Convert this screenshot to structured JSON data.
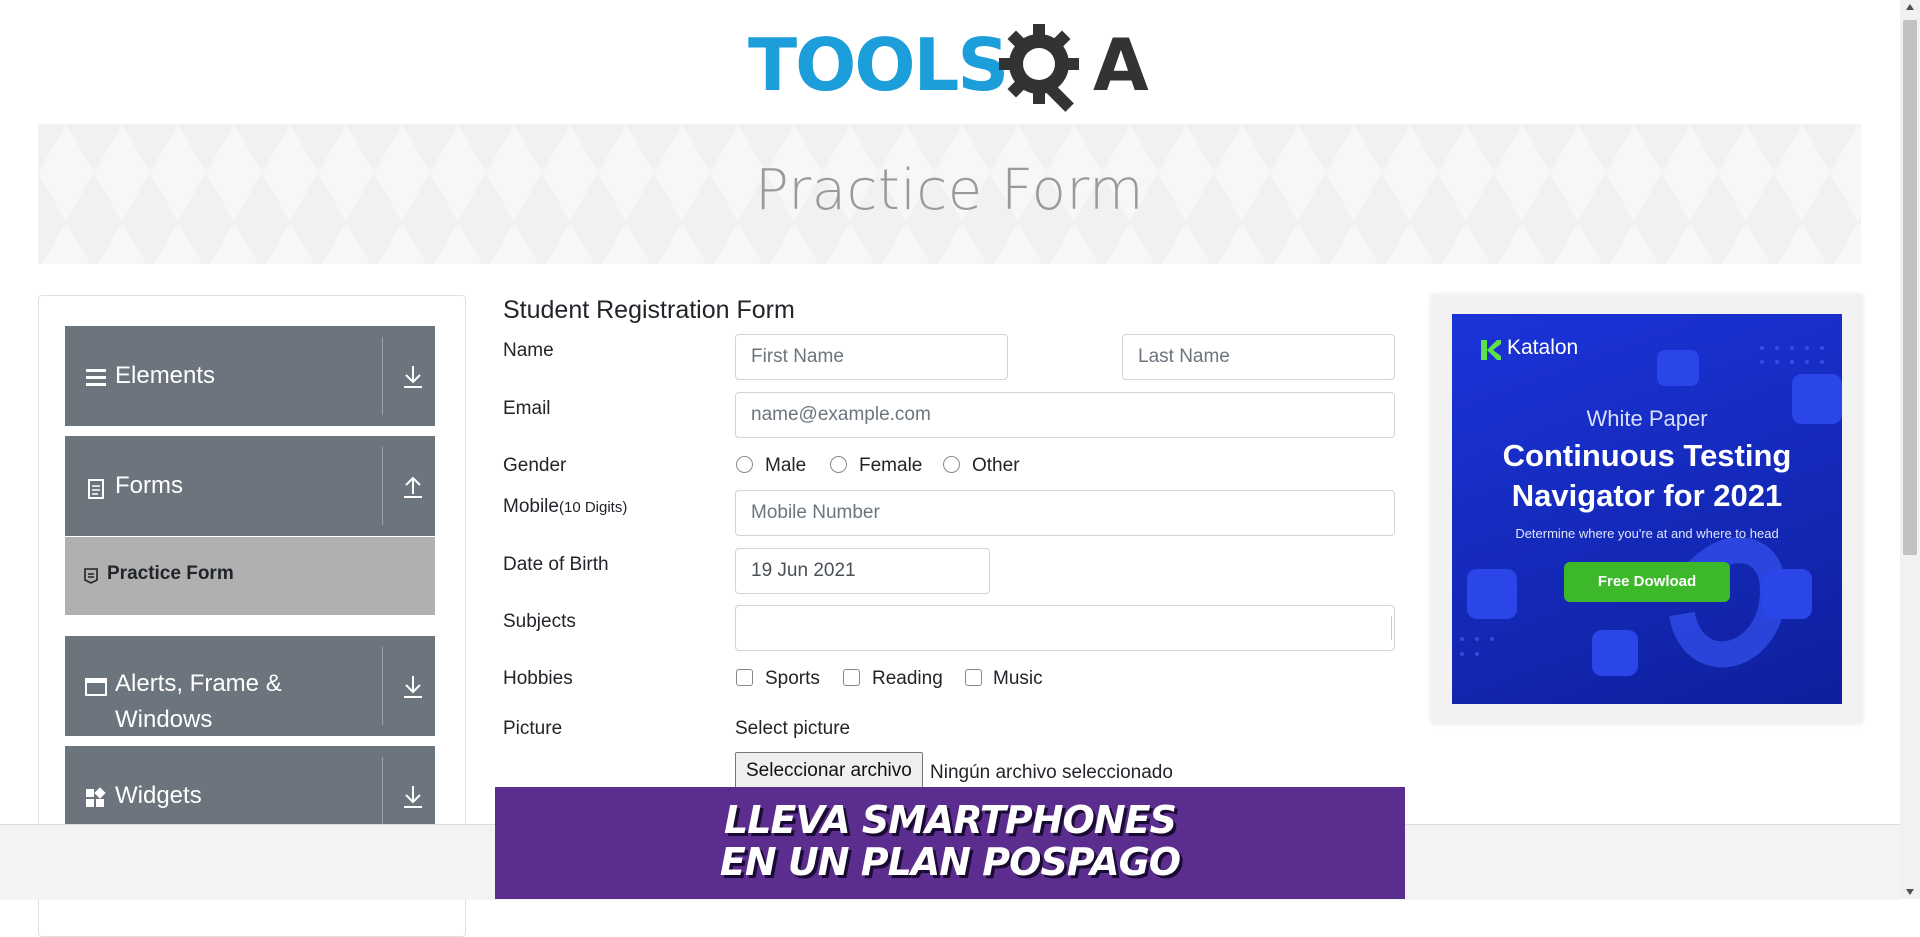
{
  "logo": {
    "text_left": "TOOLS",
    "text_right": "A",
    "alt": "ToolsQA"
  },
  "banner": {
    "title": "Practice Form"
  },
  "sidebar": {
    "groups": [
      {
        "label": "Elements",
        "icon": "list-icon",
        "arrow": "download-icon"
      },
      {
        "label": "Forms",
        "icon": "document-icon",
        "arrow": "upload-icon"
      },
      {
        "label": "Alerts, Frame & Windows",
        "icon": "window-icon",
        "arrow": "download-icon"
      },
      {
        "label": "Widgets",
        "icon": "grid-icon",
        "arrow": "download-icon"
      }
    ],
    "active_item": {
      "label": "Practice Form",
      "icon": "form-icon"
    }
  },
  "form": {
    "title": "Student Registration Form",
    "name_label": "Name",
    "first_name_placeholder": "First Name",
    "last_name_placeholder": "Last Name",
    "email_label": "Email",
    "email_placeholder": "name@example.com",
    "gender_label": "Gender",
    "gender_options": [
      "Male",
      "Female",
      "Other"
    ],
    "mobile_label": "Mobile",
    "mobile_hint": "(10 Digits)",
    "mobile_placeholder": "Mobile Number",
    "dob_label": "Date of Birth",
    "dob_value": "19 Jun 2021",
    "subjects_label": "Subjects",
    "hobbies_label": "Hobbies",
    "hobby_options": [
      "Sports",
      "Reading",
      "Music"
    ],
    "picture_label": "Picture",
    "picture_caption": "Select picture",
    "file_button": "Seleccionar archivo",
    "file_status": "Ningún archivo seleccionado"
  },
  "ad": {
    "brand": "Katalon",
    "kicker": "White Paper",
    "headline_1": "Continuous Testing",
    "headline_2": "Navigator for 2021",
    "sub": "Determine where you're at and where to head",
    "cta": "Free Dowload",
    "bg_color": "#1b34d9",
    "cta_color": "#3cb82a"
  },
  "promo": {
    "line_1": "LLEVA SMARTPHONES",
    "line_2": "EN UN PLAN POSPAGO",
    "bg_color": "#5b2d8e"
  },
  "colors": {
    "sidebar_group": "#6c757d",
    "sidebar_active": "#b0b0b0",
    "logo_blue": "#1b9ed9",
    "logo_dark": "#333333"
  }
}
